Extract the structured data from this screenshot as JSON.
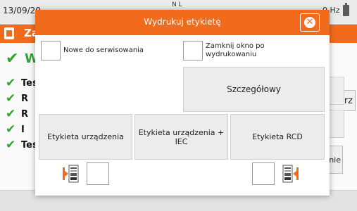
{
  "background": {
    "status_bar": {
      "date": "13/09/20",
      "nl": "N L",
      "frequency": "0 Hz"
    },
    "title_bar": {
      "title": "Za"
    },
    "result": {
      "text": "W"
    },
    "checklist": [
      "Tes",
      "R",
      "R",
      "I",
      "Tes"
    ],
    "comment_button": "ntarz",
    "side_button": "enie"
  },
  "dialog": {
    "title": "Wydrukuj etykietę",
    "new_for_service_label": "Nowe do serwisowania",
    "close_after_print_label": "Zamknij okno po wydrukowaniu",
    "detailed_button": "Szczegółowy",
    "device_label_button": "Etykieta urządzenia",
    "device_iec_label_button": "Etykieta urządzenia + IEC",
    "rcd_label_button": "Etykieta RCD"
  },
  "colors": {
    "accent": "#f26b1d",
    "pass": "#2ea52e"
  },
  "icons": {
    "close": "close-circle-icon",
    "label_left": "label-print-icon",
    "label_right": "label-print-icon"
  }
}
